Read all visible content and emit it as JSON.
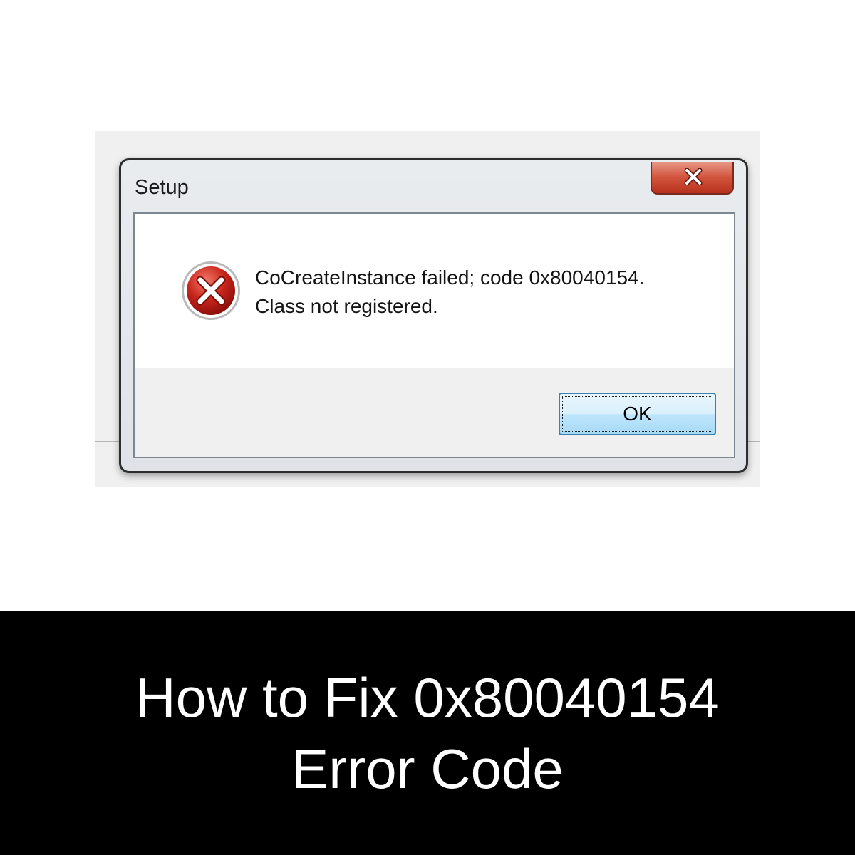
{
  "dialog": {
    "title": "Setup",
    "close_icon": "close-icon",
    "error_icon": "error-icon",
    "message_line1": "CoCreateInstance failed; code 0x80040154.",
    "message_line2": "Class not registered.",
    "ok_label": "OK"
  },
  "caption": {
    "line1": "How to Fix 0x80040154",
    "line2": "Error Code"
  },
  "colors": {
    "close_button": "#c8422b",
    "error_red": "#c0201a",
    "ok_border": "#3c7fb1",
    "caption_background": "#000000"
  }
}
